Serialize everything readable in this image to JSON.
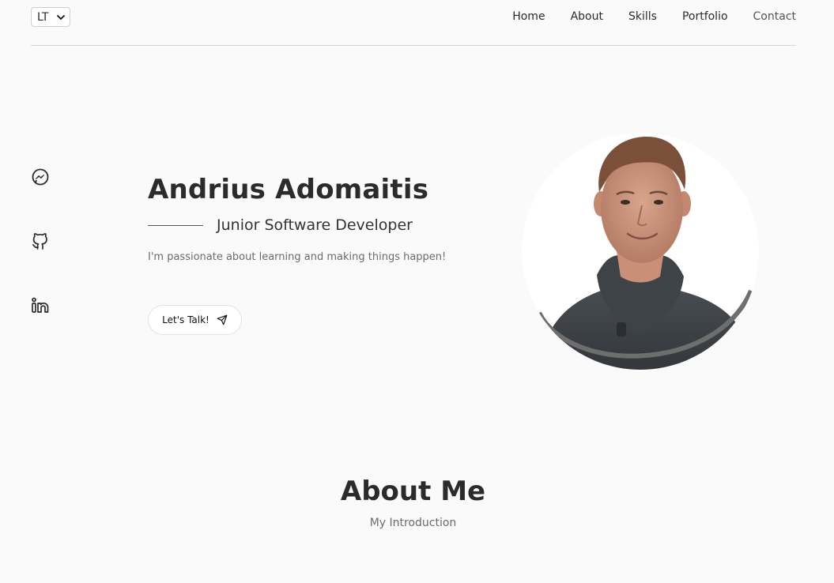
{
  "header": {
    "language": {
      "selected": "LT"
    },
    "nav": [
      {
        "label": "Home"
      },
      {
        "label": "About"
      },
      {
        "label": "Skills"
      },
      {
        "label": "Portfolio"
      },
      {
        "label": "Contact"
      }
    ]
  },
  "social": [
    {
      "icon": "messenger-icon"
    },
    {
      "icon": "github-icon"
    },
    {
      "icon": "linkedin-icon"
    }
  ],
  "hero": {
    "name": "Andrius Adomaitis",
    "subtitle": "Junior Software Developer",
    "tagline": "I'm passionate about learning and making things happen!",
    "cta_label": "Let's Talk!",
    "cta_icon": "send-icon",
    "avatar_icon": "profile-photo"
  },
  "about": {
    "title": "About Me",
    "subtitle": "My Introduction"
  },
  "colors": {
    "background": "#fafafa",
    "text": "#2b2b2b",
    "muted": "#6b6b6b",
    "divider": "#d6d6d6"
  }
}
